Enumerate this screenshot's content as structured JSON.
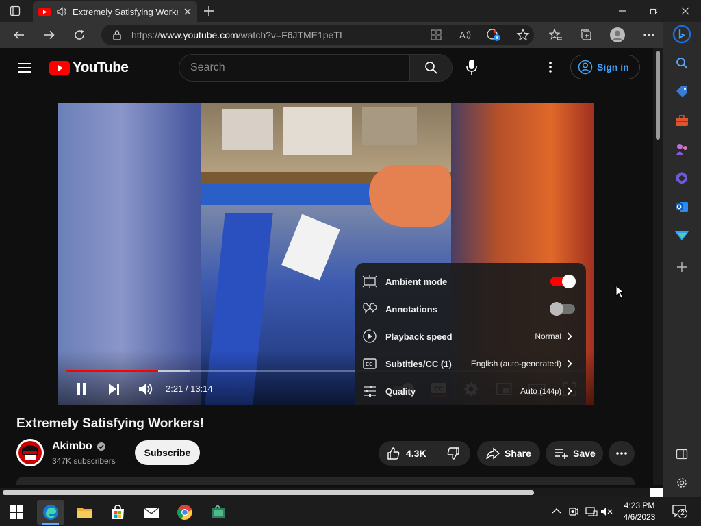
{
  "browser": {
    "tab_title": "Extremely Satisfying Workers!",
    "url_prefix": "https://",
    "url_host": "www.youtube.com",
    "url_path": "/watch?v=F6JTME1peTI"
  },
  "youtube": {
    "logo_text": "YouTube",
    "search_placeholder": "Search",
    "signin_label": "Sign in"
  },
  "player": {
    "time": "2:21 / 13:14",
    "progress_played": 0.178,
    "progress_loaded": 0.239
  },
  "settings_menu": {
    "items": [
      {
        "label": "Ambient mode",
        "toggle": true,
        "icon": "ambient-icon"
      },
      {
        "label": "Annotations",
        "toggle": false,
        "icon": "annotations-icon"
      },
      {
        "label": "Playback speed",
        "value": "Normal",
        "icon": "playback-speed-icon"
      },
      {
        "label": "Subtitles/CC (1)",
        "value": "English (auto-generated)",
        "icon": "subtitles-icon"
      },
      {
        "label": "Quality",
        "value": "Auto",
        "value_detail": "(144p)",
        "icon": "quality-icon"
      }
    ]
  },
  "video": {
    "title": "Extremely Satisfying Workers!",
    "channel": "Akimbo",
    "subscribers": "347K subscribers",
    "subscribe_label": "Subscribe",
    "likes": "4.3K",
    "share_label": "Share",
    "save_label": "Save"
  },
  "taskbar": {
    "time": "4:23 PM",
    "date": "4/6/2023",
    "notification_count": "2"
  },
  "colors": {
    "yt_red": "#ff0000",
    "link_blue": "#3ea6ff",
    "toggle_on": "#ff0000"
  }
}
